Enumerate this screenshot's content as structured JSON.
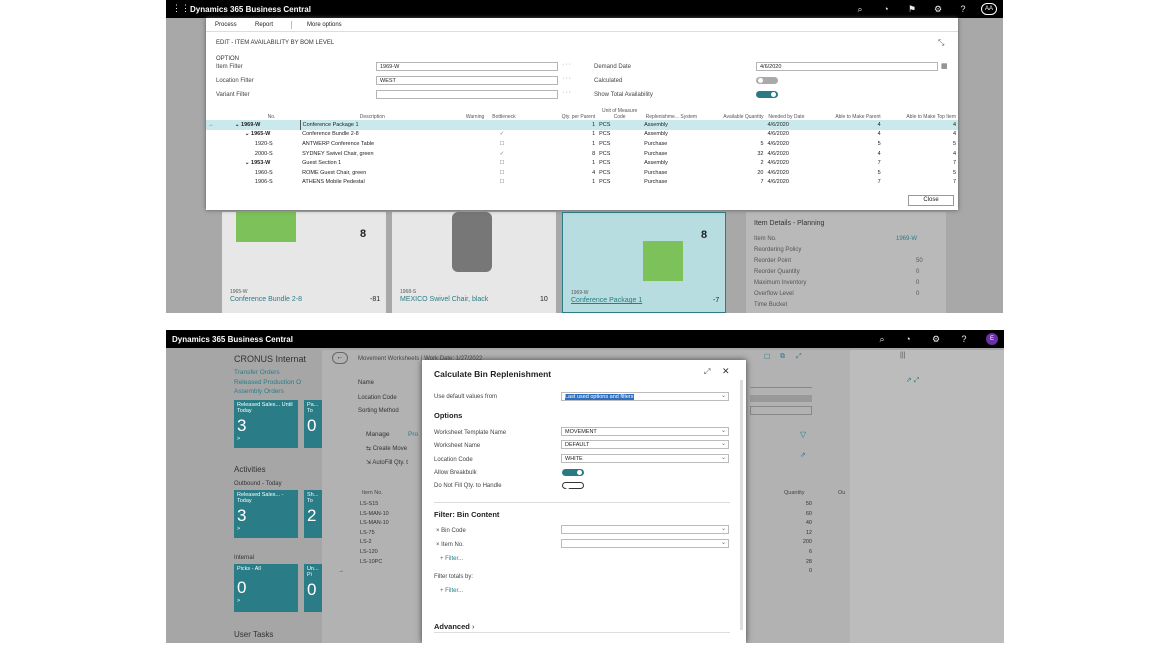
{
  "top": {
    "app_title": "Dynamics 365 Business Central",
    "avatar": "AA",
    "menu": [
      "Process",
      "Report",
      "More options"
    ],
    "dialog_title": "EDIT - ITEM AVAILABILITY BY BOM LEVEL",
    "section": "OPTION",
    "fields": {
      "item_filter_label": "Item Filter",
      "item_filter": "1969-W",
      "location_filter_label": "Location Filter",
      "location_filter": "WEST",
      "variant_filter_label": "Variant Filter",
      "variant_filter": "",
      "demand_date_label": "Demand Date",
      "demand_date": "4/6/2020",
      "calculated_label": "Calculated",
      "show_total_label": "Show Total Availability"
    },
    "columns": [
      "No.",
      "Description",
      "Warning",
      "Bottleneck",
      "Qty. per Parent",
      "Unit of Measure Code",
      "Replenishme... System",
      "Available Quantity",
      "Needed by Date",
      "Able to Make Parent",
      "Able to Make Top Item"
    ],
    "rows": [
      {
        "no": "1969-W",
        "desc": "Conference Package 1",
        "qty": "1",
        "uom": "PCS",
        "sys": "Assembly",
        "avail": "",
        "date": "4/6/2020",
        "parent": "4",
        "top": "4"
      },
      {
        "no": "1965-W",
        "desc": "Conference Bundle 2-8",
        "qty": "1",
        "uom": "PCS",
        "sys": "Assembly",
        "avail": "",
        "date": "4/6/2020",
        "parent": "4",
        "top": "4"
      },
      {
        "no": "1920-S",
        "desc": "ANTWERP Conference Table",
        "qty": "1",
        "uom": "PCS",
        "sys": "Purchase",
        "avail": "5",
        "date": "4/6/2020",
        "parent": "5",
        "top": "5"
      },
      {
        "no": "2000-S",
        "desc": "SYDNEY Swivel Chair, green",
        "qty": "8",
        "uom": "PCS",
        "sys": "Purchase",
        "avail": "32",
        "date": "4/6/2020",
        "parent": "4",
        "top": "4"
      },
      {
        "no": "1953-W",
        "desc": "Guest Section 1",
        "qty": "1",
        "uom": "PCS",
        "sys": "Assembly",
        "avail": "2",
        "date": "4/6/2020",
        "parent": "7",
        "top": "7"
      },
      {
        "no": "1960-S",
        "desc": "ROME Guest Chair, green",
        "qty": "4",
        "uom": "PCS",
        "sys": "Purchase",
        "avail": "20",
        "date": "4/6/2020",
        "parent": "5",
        "top": "5"
      },
      {
        "no": "1906-S",
        "desc": "ATHENS Mobile Pedestal",
        "qty": "1",
        "uom": "PCS",
        "sys": "Purchase",
        "avail": "7",
        "date": "4/6/2020",
        "parent": "7",
        "top": "7"
      }
    ],
    "close_label": "Close",
    "bg": {
      "badge8a": "8",
      "badge8b": "8",
      "item1_no": "1965-W",
      "item1_name": "Conference Bundle 2-8",
      "item1_qty": "-81",
      "item2_no": "1968-S",
      "item2_name": "MEXICO Swivel Chair, black",
      "item2_qty": "10",
      "item3_no": "1969-W",
      "item3_name": "Conference Package 1",
      "item3_qty": "-7",
      "details_title": "Item Details - Planning",
      "details": [
        {
          "label": "Item No.",
          "value": "1969-W"
        },
        {
          "label": "Reordering Policy",
          "value": ""
        },
        {
          "label": "Reorder Point",
          "value": "50"
        },
        {
          "label": "Reorder Quantity",
          "value": "0"
        },
        {
          "label": "Maximum Inventory",
          "value": "0"
        },
        {
          "label": "Overflow Level",
          "value": "0"
        },
        {
          "label": "Time Bucket",
          "value": ""
        }
      ]
    }
  },
  "bottom": {
    "app_title": "Dynamics 365 Business Central",
    "avatar": "E",
    "company": "CRONUS Internat",
    "links": [
      "Transfer Orders",
      "Released Production O",
      "Assembly Orders"
    ],
    "tile1": {
      "label": "Released Sales... Until Today",
      "value": "3"
    },
    "tile1b": {
      "label": "Pa... To",
      "value": "0"
    },
    "activities": "Activities",
    "outbound": "Outbound - Today",
    "tile2": {
      "label": "Released Sales... - Today",
      "value": "3"
    },
    "tile2b": {
      "label": "Sh... To",
      "value": "2"
    },
    "internal": "Internal",
    "tile3": {
      "label": "Picks - All",
      "value": "0"
    },
    "tile3b": {
      "label": "Un... Pi",
      "value": "0"
    },
    "user_tasks": "User Tasks",
    "worksheet_title": "Movement Worksheets | Work Date: 1/27/2022",
    "ws_labels": [
      "Name",
      "Location Code",
      "Sorting Method"
    ],
    "manage": "Manage",
    "pro": "Pro",
    "create_move": "Create Move",
    "autofill": "AutoFill Qty. t",
    "item_no_header": "Item No.",
    "items": [
      "LS-S15",
      "LS-MAN-10",
      "LS-MAN-10",
      "LS-75",
      "LS-2",
      "LS-120",
      "LS-10PC"
    ],
    "qty_header": "Quantity",
    "out_header": "Ou",
    "quantities": [
      "50",
      "60",
      "40",
      "12",
      "200",
      "6",
      "28",
      "0"
    ],
    "dialog": {
      "title": "Calculate Bin Replenishment",
      "use_default_label": "Use default values from",
      "use_default": "Last used options and filters",
      "options": "Options",
      "template_label": "Worksheet Template Name",
      "template": "MOVEMENT",
      "name_label": "Worksheet Name",
      "name": "DEFAULT",
      "location_label": "Location Code",
      "location": "WHITE",
      "breakbulk_label": "Allow Breakbulk",
      "donot_label": "Do Not Fill Qty. to Handle",
      "filter_title": "Filter: Bin Content",
      "bin_code_label": "× Bin Code",
      "item_no_label": "× Item No.",
      "filter_link": "Filter...",
      "totals_label": "Filter totals by:",
      "filter_link2": "Filter...",
      "advanced": "Advanced"
    }
  }
}
